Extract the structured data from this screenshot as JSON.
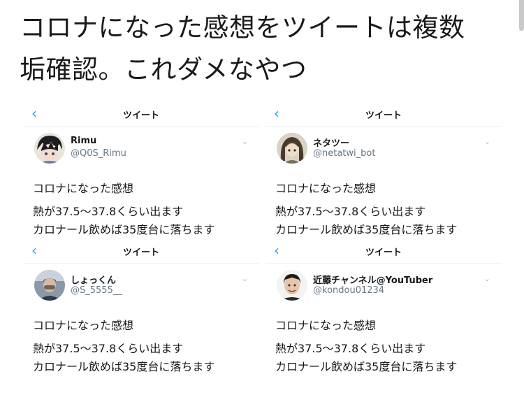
{
  "headline": {
    "line1": "コロナになった感想をツイートは複数",
    "line2": "垢確認。これダメなやつ"
  },
  "tweet_text": {
    "line1": "コロナになった感想",
    "line2": "熱が37.5〜37.8くらい出ます",
    "line3": "カロナール飲めば35度台に落ちます"
  },
  "panels": [
    {
      "header_title": "ツイート",
      "back_icon": "‹",
      "name": "Rimu",
      "handle": "@Q0S_Rimu",
      "avatar": "anime-avatar-icon"
    },
    {
      "header_title": "ツイート",
      "back_icon": "‹",
      "name": "ネタツー",
      "handle": "@netatwi_bot",
      "avatar": "anime-girl-avatar-icon"
    },
    {
      "header_title": "ツイート",
      "back_icon": "‹",
      "name": "しょっくん",
      "handle": "@S_5555__",
      "avatar": "photo-avatar-icon"
    },
    {
      "header_title": "ツイート",
      "back_icon": "‹",
      "name": "近藤チャンネル@YouTuber",
      "handle": "@kondou01234",
      "avatar": "man-face-avatar-icon"
    }
  ],
  "colors": {
    "accent": "#1da1f2",
    "handle": "#657786",
    "text": "#14171a"
  },
  "chevron_icon": "⌄"
}
